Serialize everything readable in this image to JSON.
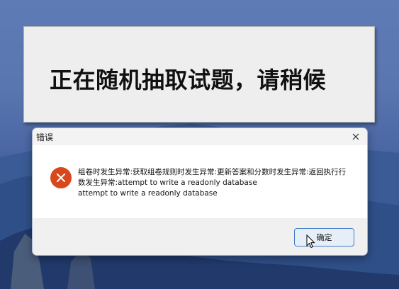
{
  "splash": {
    "message": "正在随机抽取试题，请稍候"
  },
  "dialog": {
    "title": "错误",
    "icon": "error-icon",
    "message_line1": "组卷时发生异常:获取组卷规则时发生异常:更新答案和分数时发生异常:返回执行行数发生异常:attempt to write a readonly database",
    "message_line2": "attempt to write a readonly database",
    "ok_label": "确定"
  },
  "colors": {
    "error_red": "#d8481c",
    "button_border": "#3d7bc4",
    "wallpaper_blue": "#5a76b0"
  }
}
